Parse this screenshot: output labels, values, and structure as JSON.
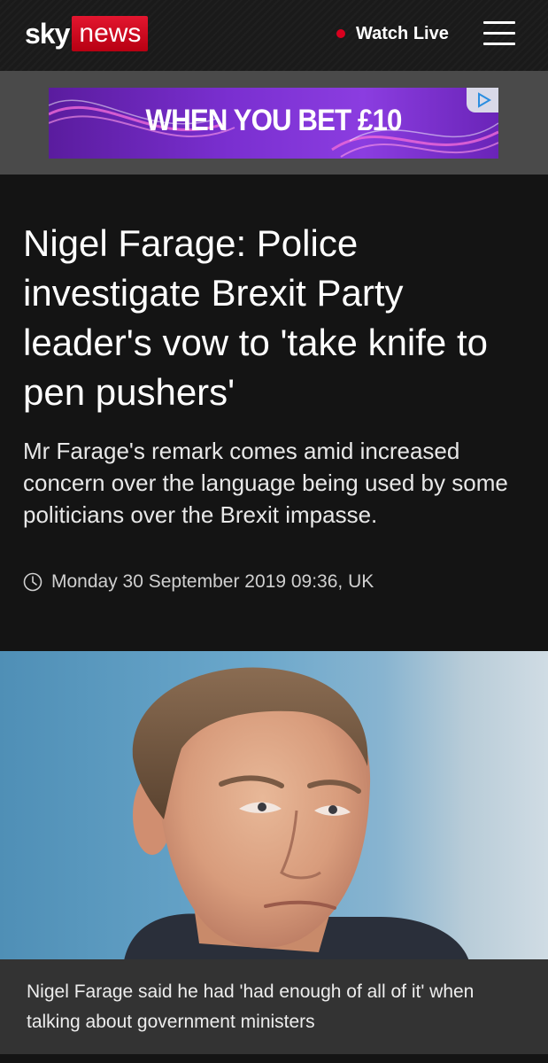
{
  "header": {
    "logo_sky": "sky",
    "logo_news": "news",
    "watch_live_label": "Watch Live",
    "menu_icon": "hamburger-menu-icon",
    "live_dot_color": "#d8001e",
    "brand_red": "#d8001e"
  },
  "ad": {
    "text": "WHEN YOU BET £10",
    "choice_icon": "ad-choices-icon"
  },
  "article": {
    "headline": "Nigel Farage: Police investigate Brexit Party leader's vow to 'take knife to pen pushers'",
    "standfirst": "Mr Farage's remark comes amid increased concern over the language being used by some politicians over the Brexit impasse.",
    "timestamp": "Monday 30 September 2019 09:36, UK",
    "timestamp_icon": "clock-icon"
  },
  "image": {
    "caption": "Nigel Farage said he had 'had enough of all of it' when talking about government ministers"
  }
}
